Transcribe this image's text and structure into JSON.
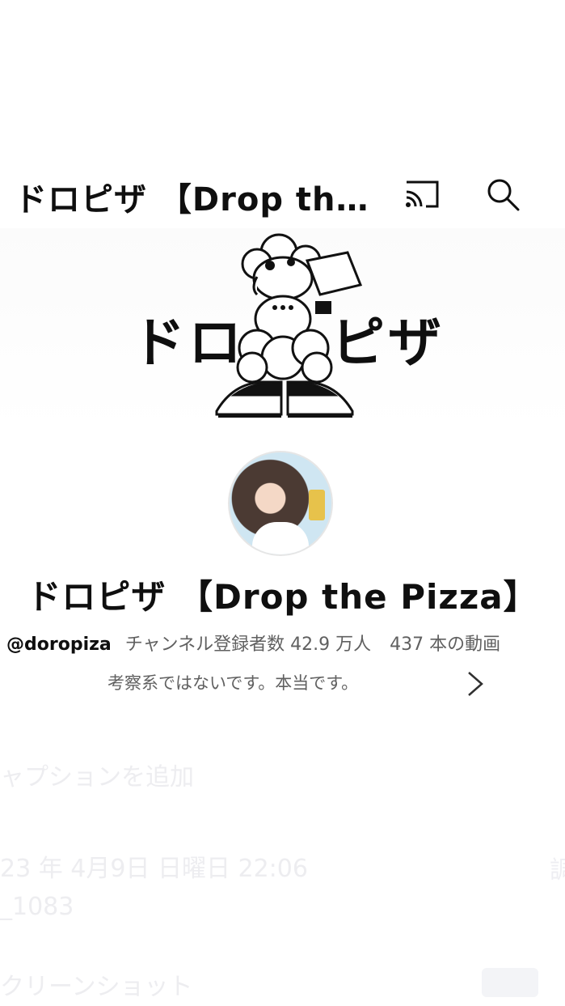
{
  "header": {
    "title": "ドロピザ 【Drop th…",
    "cast_icon": "cast-icon",
    "search_icon": "search-icon"
  },
  "banner": {
    "left_text": "ドロ",
    "right_text": "ピザ"
  },
  "channel": {
    "name": "ドロピザ 【Drop the Pizza】",
    "handle": "@doropiza",
    "subscribers": "チャンネル登録者数 42.9 万人",
    "videos": "437 本の動画",
    "description": "考察系ではないです。本当です。"
  },
  "overlay_faded": {
    "caption": "ャプションを追加",
    "datetime": "23 年 4月9日 日曜日 22:06",
    "right_fragment": "調",
    "filename": "_1083",
    "screenshot_label": "クリーンショット"
  }
}
